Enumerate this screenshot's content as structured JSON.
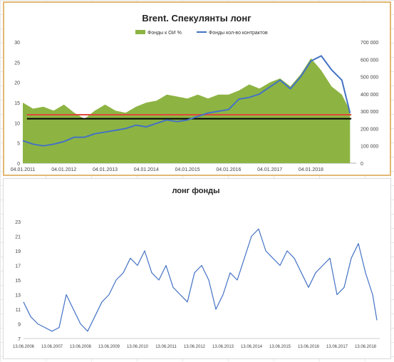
{
  "chart_data": [
    {
      "type": "area",
      "title": "Brent. Спекулянты лонг",
      "legend_placement": "top-center",
      "x_ticks": [
        "04.01.2011",
        "04.01.2012",
        "04.01.2013",
        "04.01.2014",
        "04.01.2015",
        "04.01.2016",
        "04.01.2017",
        "04.01.2018"
      ],
      "ylim_left": [
        0,
        30
      ],
      "yticks_left": [
        0,
        5,
        10,
        15,
        20,
        25,
        30
      ],
      "ylim_right": [
        0,
        700000
      ],
      "yticks_right": [
        0,
        100000,
        200000,
        300000,
        400000,
        500000,
        600000,
        700000
      ],
      "x_years": [
        2011.0,
        2011.25,
        2011.5,
        2011.75,
        2012.0,
        2012.25,
        2012.5,
        2012.75,
        2013.0,
        2013.25,
        2013.5,
        2013.75,
        2014.0,
        2014.25,
        2014.5,
        2014.75,
        2015.0,
        2015.25,
        2015.5,
        2015.75,
        2016.0,
        2016.25,
        2016.5,
        2016.75,
        2017.0,
        2017.25,
        2017.5,
        2017.75,
        2018.0,
        2018.25,
        2018.5,
        2018.75,
        2018.95
      ],
      "series": [
        {
          "name": "Фонды к ОИ %",
          "axis": "left",
          "color": "#8db443",
          "values": [
            15,
            13.5,
            14,
            13,
            14.5,
            12.5,
            11,
            13,
            14.5,
            13,
            12.5,
            14,
            15,
            15.5,
            17,
            16.5,
            16,
            17,
            16,
            17,
            17,
            18,
            19.5,
            18.5,
            20,
            21,
            19,
            22,
            26,
            23,
            19,
            17,
            13
          ]
        },
        {
          "name": "Фонды кол-во контрактов",
          "axis": "right",
          "color": "#4472c4",
          "values": [
            130000,
            110000,
            100000,
            110000,
            125000,
            150000,
            150000,
            170000,
            180000,
            190000,
            200000,
            220000,
            210000,
            230000,
            250000,
            240000,
            250000,
            270000,
            290000,
            300000,
            310000,
            370000,
            380000,
            400000,
            440000,
            480000,
            430000,
            500000,
            590000,
            620000,
            540000,
            480000,
            290000
          ]
        }
      ],
      "reference_lines": [
        {
          "name": "",
          "value": 12,
          "axis": "left",
          "color": "#e0483a"
        },
        {
          "name": "",
          "value": 11,
          "axis": "left",
          "color": "#000000"
        }
      ]
    },
    {
      "type": "line",
      "title": "лонг фонды",
      "ylim": [
        7,
        23
      ],
      "yticks": [
        7,
        9,
        11,
        13,
        15,
        17,
        19,
        21,
        23
      ],
      "x_ticks": [
        "13.06.2006",
        "13.06.2007",
        "13.06.2008",
        "13.06.2009",
        "13.06.2010",
        "13.06.2011",
        "13.06.2012",
        "13.06.2013",
        "13.06.2014",
        "13.06.2015",
        "13.06.2016",
        "13.06.2017",
        "13.06.2018"
      ],
      "x_years": [
        2006.45,
        2006.7,
        2006.95,
        2007.2,
        2007.45,
        2007.7,
        2007.95,
        2008.2,
        2008.45,
        2008.7,
        2008.95,
        2009.2,
        2009.45,
        2009.7,
        2009.95,
        2010.2,
        2010.45,
        2010.7,
        2010.95,
        2011.2,
        2011.45,
        2011.7,
        2011.95,
        2012.2,
        2012.45,
        2012.7,
        2012.95,
        2013.2,
        2013.45,
        2013.7,
        2013.95,
        2014.2,
        2014.45,
        2014.7,
        2014.95,
        2015.2,
        2015.45,
        2015.7,
        2015.95,
        2016.2,
        2016.45,
        2016.7,
        2016.95,
        2017.2,
        2017.45,
        2017.7,
        2017.95,
        2018.2,
        2018.45,
        2018.7,
        2018.85
      ],
      "series": [
        {
          "name": "",
          "color": "#4472c4",
          "values": [
            12,
            10,
            9,
            8.5,
            8,
            8.5,
            13,
            11,
            9,
            8,
            10,
            12,
            13,
            15,
            16,
            18,
            17,
            19,
            16,
            15,
            17,
            14,
            13,
            12,
            16,
            17,
            15,
            11,
            13,
            16,
            15,
            18,
            21,
            22,
            19,
            18,
            17,
            19,
            18,
            16,
            14,
            16,
            17,
            18,
            13,
            14,
            18,
            20,
            16,
            13,
            9.5
          ]
        }
      ]
    }
  ]
}
